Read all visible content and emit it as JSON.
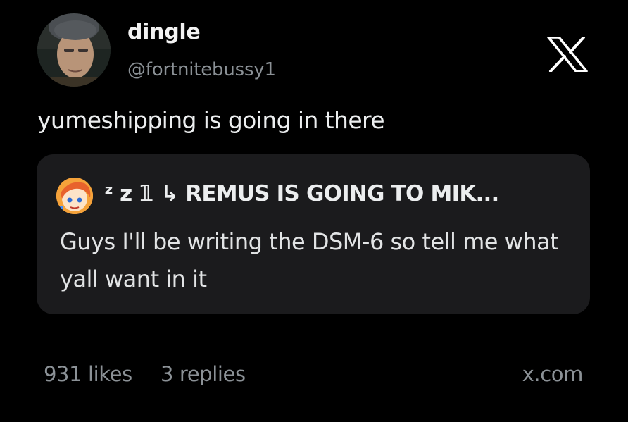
{
  "author": {
    "display_name": "dingle",
    "handle": "@fortnitebussy1",
    "avatar_icon": "profile-photo"
  },
  "brand": {
    "icon": "x-logo-icon"
  },
  "tweet": {
    "text": "yumeshipping is going in there"
  },
  "quote": {
    "author": "ᶻ z 𝟙 ↳ REMUS IS GOING TO MIK...",
    "text": "Guys I'll be writing the DSM-6 so tell me what yall want in it",
    "avatar_icon": "anime-avatar"
  },
  "stats": {
    "likes": "931 likes",
    "replies": "3 replies",
    "source": "x.com"
  },
  "colors": {
    "background": "#000000",
    "card": "#1b1b1d",
    "muted_text": "#8b9196",
    "primary_text": "#e7e9ea"
  }
}
